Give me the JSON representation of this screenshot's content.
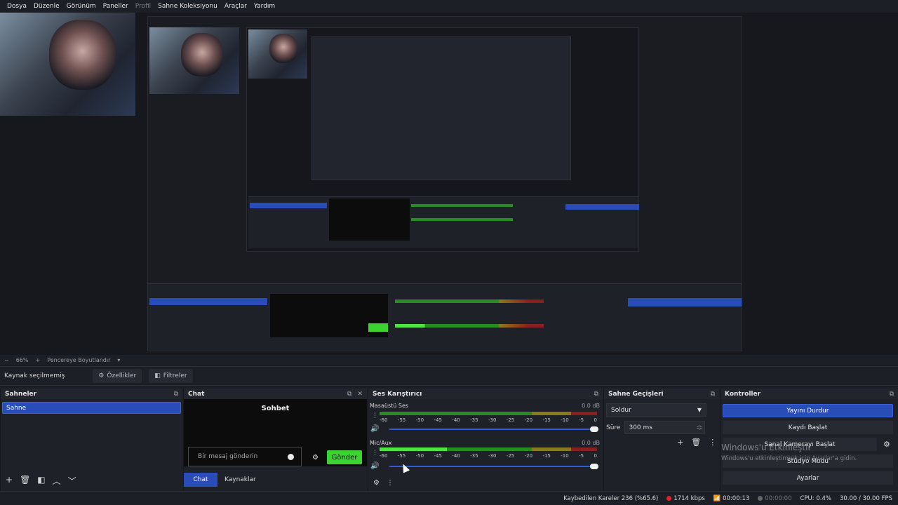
{
  "menu": {
    "items": [
      "Dosya",
      "Düzenle",
      "Görünüm",
      "Paneller",
      "Profil",
      "Sahne Koleksiyonu",
      "Araçlar",
      "Yardım"
    ]
  },
  "zoom": {
    "minus": "−",
    "value": "66%",
    "plus": "+",
    "fit_label": "Pencereye Boyutlandır",
    "arrow": "▾"
  },
  "source_bar": {
    "no_source": "Kaynak seçilmemiş",
    "properties": "Özellikler",
    "filters": "Filtreler"
  },
  "scenes": {
    "title": "Sahneler",
    "items": [
      "Sahne"
    ],
    "footer_icons": [
      "add-icon",
      "trash-icon",
      "filter-icon",
      "up-icon",
      "down-icon"
    ]
  },
  "chat": {
    "title": "Chat",
    "heading": "Sohbet",
    "input_placeholder": "Bir mesaj gönderin",
    "send": "Gönder",
    "tabs": [
      "Chat",
      "Kaynaklar"
    ]
  },
  "mixer": {
    "title": "Ses Karıştırıcı",
    "scale": [
      "-60",
      "-55",
      "-50",
      "-45",
      "-40",
      "-35",
      "-30",
      "-25",
      "-20",
      "-15",
      "-10",
      "-5",
      "0"
    ],
    "channels": [
      {
        "name": "Masaüstü Ses",
        "db": "0.0 dB",
        "level": 0.0
      },
      {
        "name": "Mic/Aux",
        "db": "0.0 dB",
        "level": 0.31
      }
    ]
  },
  "transitions": {
    "title": "Sahne Geçişleri",
    "selected": "Soldur",
    "duration_label": "Süre",
    "duration_value": "300 ms"
  },
  "controls": {
    "title": "Kontroller",
    "buttons": [
      "Yayını Durdur",
      "Kaydı Başlat",
      "Sanal Kamerayı Başlat",
      "Stüdyo Modu",
      "Ayarlar"
    ],
    "watermark_title": "Windows'u Etkinleştir",
    "watermark_sub": "Windows'u etkinleştirmek için Ayarlar'a gidin."
  },
  "status": {
    "dropped": "Kaybedilen Kareler 236 (%65.6)",
    "bitrate": "1714 kbps",
    "stream_time": "00:00:13",
    "rec_time": "00:00:00",
    "cpu": "CPU: 0.4%",
    "fps": "30.00 / 30.00 FPS"
  },
  "colors": {
    "accent": "#284cb8",
    "send_green": "#3bd32f",
    "live_red": "#e0222a",
    "bg": "#1d1f26"
  }
}
